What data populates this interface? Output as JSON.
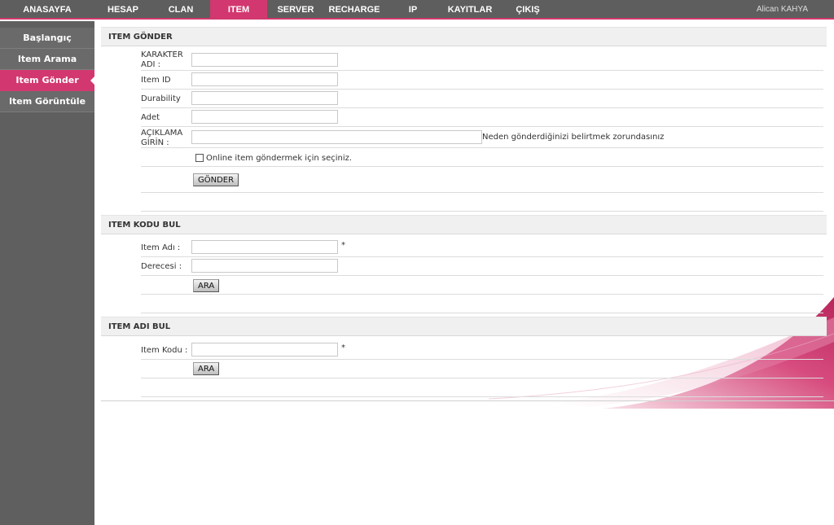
{
  "nav": {
    "items": [
      {
        "label": "ANASAYFA"
      },
      {
        "label": "HESAP"
      },
      {
        "label": "CLAN"
      },
      {
        "label": "ITEM"
      },
      {
        "label": "SERVER"
      },
      {
        "label": "RECHARGE"
      },
      {
        "label": "IP"
      },
      {
        "label": "KAYITLAR"
      },
      {
        "label": "ÇIKIŞ"
      }
    ],
    "active": "ITEM",
    "user": "Alican KAHYA"
  },
  "sidebar": {
    "items": [
      {
        "label": "Başlangıç"
      },
      {
        "label": "Item Arama"
      },
      {
        "label": "Item Gönder"
      },
      {
        "label": "Item Görüntüle"
      }
    ],
    "active": "Item Gönder"
  },
  "send": {
    "title": "ITEM GÖNDER",
    "char_label_1": "KARAKTER",
    "char_label_2": "ADI :",
    "item_id_label": "Item ID",
    "durability_label": "Durability",
    "count_label": "Adet",
    "desc_label_1": "AÇIKLAMA",
    "desc_label_2": "GİRİN :",
    "desc_note": "Neden gönderdiğinizi belirtmek zorundasınız",
    "online_label": "Online item göndermek için seçiniz.",
    "submit": "GÖNDER"
  },
  "find_code": {
    "title": "ITEM KODU BUL",
    "name_label": "Item Adı :",
    "grade_label": "Derecesi :",
    "required": "*",
    "submit": "ARA"
  },
  "find_name": {
    "title": "ITEM ADI BUL",
    "code_label": "Item Kodu :",
    "required": "*",
    "submit": "ARA"
  },
  "colors": {
    "accent": "#d2386f",
    "nav_bg": "#5e5e5e",
    "sidebar_bg": "#5f5f5f"
  }
}
